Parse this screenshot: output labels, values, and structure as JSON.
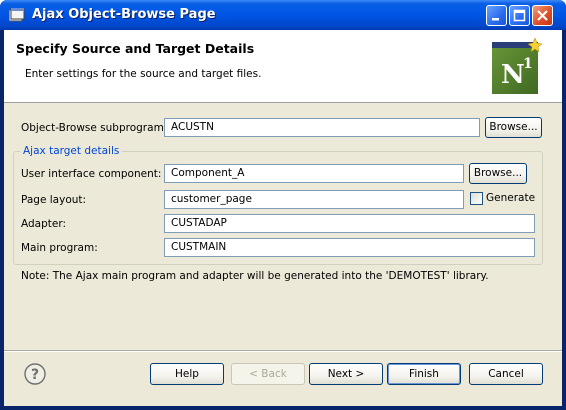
{
  "window": {
    "title": "Ajax Object-Browse Page"
  },
  "header": {
    "title": "Specify Source and Target Details",
    "description": "Enter settings for the source and target files.",
    "logo_text": "N1"
  },
  "form": {
    "subprogram_label": "Object-Browse subprogram:",
    "subprogram_value": "ACUSTN",
    "subprogram_browse": "Browse...",
    "group_title": "Ajax target details",
    "ui_component_label": "User interface component:",
    "ui_component_value": "Component_A",
    "ui_component_browse": "Browse...",
    "page_layout_label": "Page layout:",
    "page_layout_value": "customer_page",
    "generate_label": "Generate",
    "generate_checked": false,
    "adapter_label": "Adapter:",
    "adapter_value": "CUSTADAP",
    "main_program_label": "Main program:",
    "main_program_value": "CUSTMAIN",
    "note": "Note: The Ajax main program and adapter will be generated into the 'DEMOTEST' library."
  },
  "buttons": {
    "help": "Help",
    "back": "< Back",
    "next": "Next >",
    "finish": "Finish",
    "cancel": "Cancel"
  },
  "icons": {
    "app": "window-app-icon",
    "minimize": "minimize-icon",
    "maximize": "maximize-icon",
    "close": "close-icon",
    "help": "help-circle-icon"
  },
  "colors": {
    "titlebar": "#0055e5",
    "dialog_bg": "#ece9d8",
    "group_title": "#0046d5",
    "logo_bg": "#4e7d2c"
  }
}
